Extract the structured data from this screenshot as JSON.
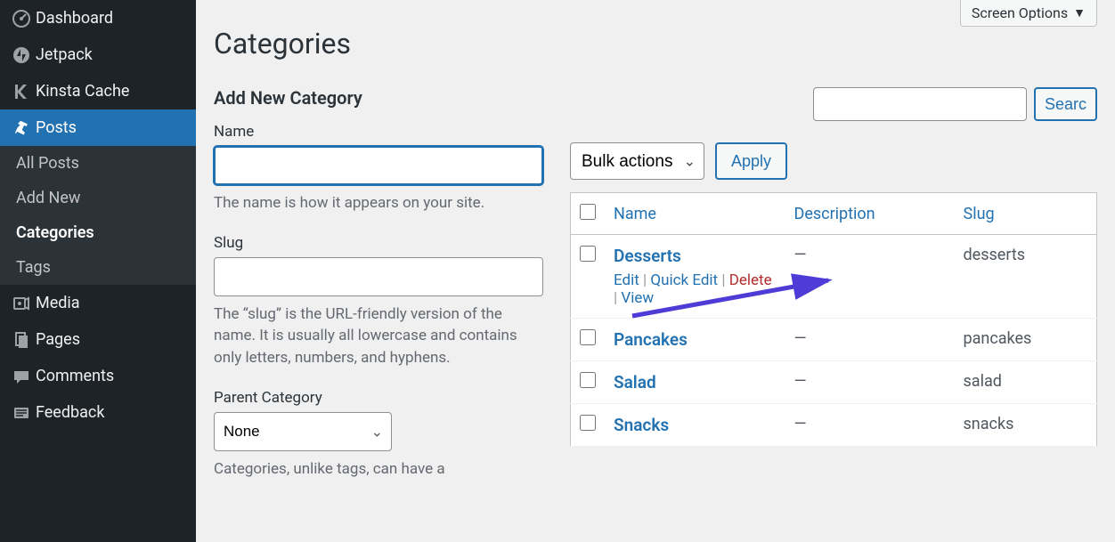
{
  "sidebar": {
    "items": [
      {
        "label": "Dashboard",
        "icon": "dashboard"
      },
      {
        "label": "Jetpack",
        "icon": "jetpack"
      },
      {
        "label": "Kinsta Cache",
        "icon": "kinsta"
      },
      {
        "label": "Posts",
        "icon": "pin",
        "active": true,
        "subitems": [
          {
            "label": "All Posts"
          },
          {
            "label": "Add New"
          },
          {
            "label": "Categories",
            "current": true
          },
          {
            "label": "Tags"
          }
        ]
      },
      {
        "label": "Media",
        "icon": "media"
      },
      {
        "label": "Pages",
        "icon": "pages"
      },
      {
        "label": "Comments",
        "icon": "comments"
      },
      {
        "label": "Feedback",
        "icon": "feedback"
      }
    ]
  },
  "header": {
    "screen_options": "Screen Options",
    "page_title": "Categories"
  },
  "form": {
    "heading": "Add New Category",
    "name_label": "Name",
    "name_value": "",
    "name_help": "The name is how it appears on your site.",
    "slug_label": "Slug",
    "slug_value": "",
    "slug_help": "The “slug” is the URL-friendly version of the name. It is usually all lowercase and contains only letters, numbers, and hyphens.",
    "parent_label": "Parent Category",
    "parent_value": "None",
    "parent_help": "Categories, unlike tags, can have a"
  },
  "list": {
    "search_button": "Searc",
    "bulk_value": "Bulk actions",
    "apply_label": "Apply",
    "columns": {
      "name": "Name",
      "description": "Description",
      "slug": "Slug"
    },
    "rows": [
      {
        "name": "Desserts",
        "description": "—",
        "slug": "desserts",
        "show_actions": true,
        "actions": {
          "edit": "Edit",
          "quick": "Quick Edit",
          "delete": "Delete",
          "view": "View"
        }
      },
      {
        "name": "Pancakes",
        "description": "—",
        "slug": "pancakes"
      },
      {
        "name": "Salad",
        "description": "—",
        "slug": "salad"
      },
      {
        "name": "Snacks",
        "description": "—",
        "slug": "snacks"
      }
    ]
  }
}
